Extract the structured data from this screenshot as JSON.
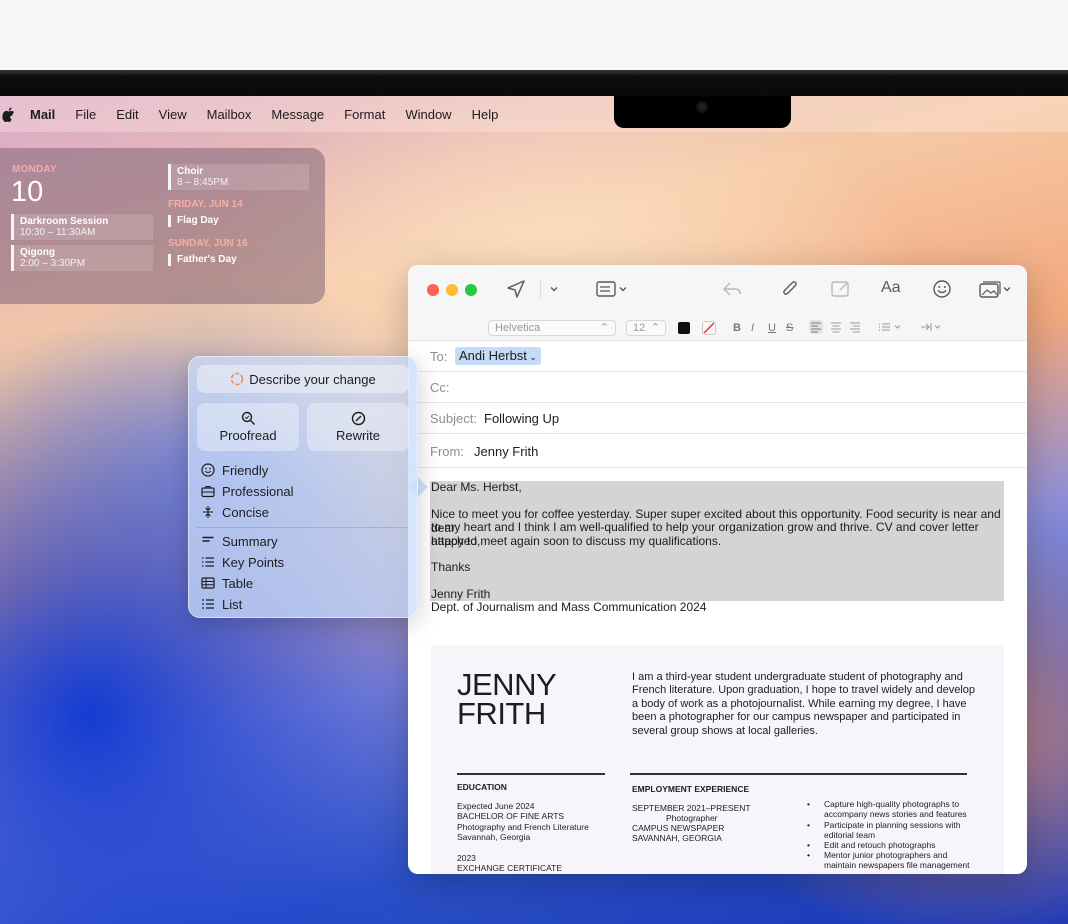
{
  "menubar": {
    "app": "Mail",
    "items": [
      "File",
      "Edit",
      "View",
      "Mailbox",
      "Message",
      "Format",
      "Window",
      "Help"
    ]
  },
  "widget": {
    "day": "MONDAY",
    "date": "10",
    "events_left": [
      {
        "title": "Darkroom Session",
        "time": "10:30 – 11:30AM"
      },
      {
        "title": "Qigong",
        "time": "2:00 – 3:30PM"
      }
    ],
    "choir": {
      "title": "Choir",
      "time": "8 – 8:45PM"
    },
    "friday_header": "FRIDAY, JUN 14",
    "friday_event": "Flag Day",
    "sunday_header": "SUNDAY, JUN 16",
    "sunday_event": "Father's Day"
  },
  "format_bar": {
    "font": "Helvetica",
    "size": "12",
    "bold": "B",
    "italic": "I",
    "underline": "U",
    "strike": "S"
  },
  "mail": {
    "to_label": "To:",
    "to_value": "Andi Herbst",
    "cc_label": "Cc:",
    "subject_label": "Subject:",
    "subject_value": "Following Up",
    "from_label": "From:",
    "from_value": "Jenny Frith",
    "font_button": "Aa",
    "body": {
      "greeting": "Dear Ms. Herbst,",
      "line1": "Nice to meet you for coffee yesterday. Super super excited about this opportunity. Food security is near and dear",
      "line2": "to my heart and I think I am well-qualified to help your organization grow and thrive. CV and cover letter attached,",
      "line3": "happy to meet again soon to discuss my qualifications.",
      "thanks": "Thanks",
      "sig_name": "Jenny Frith",
      "sig_dept": "Dept. of Journalism and Mass Communication 2024"
    }
  },
  "resume": {
    "name_line1": "JENNY",
    "name_line2": "FRITH",
    "bio": "I am a third-year student undergraduate student of photography and French literature. Upon graduation, I hope to travel widely and develop a body of work as a photojournalist. While earning my degree, I have been a photographer for our campus newspaper and participated in several group shows at local galleries.",
    "education_header": "EDUCATION",
    "edu_1": "Expected June 2024",
    "edu_2": "BACHELOR OF FINE ARTS",
    "edu_3": "Photography and French Literature",
    "edu_4": "Savannah, Georgia",
    "edu_5": "2023",
    "edu_6": "EXCHANGE CERTIFICATE",
    "employment_header": "EMPLOYMENT EXPERIENCE",
    "emp_1": "SEPTEMBER 2021–PRESENT",
    "emp_2": "Photographer",
    "emp_3": "CAMPUS NEWSPAPER",
    "emp_4": "SAVANNAH, GEORGIA",
    "bullets": [
      "Capture high-quality photographs to",
      "accompany news stories and features",
      "Participate in planning sessions with",
      "editorial team",
      "Edit and retouch photographs",
      "Mentor junior photographers and",
      "maintain newspapers file management"
    ]
  },
  "writing_tools": {
    "describe": "Describe your change",
    "proofread": "Proofread",
    "rewrite": "Rewrite",
    "tones": [
      "Friendly",
      "Professional",
      "Concise"
    ],
    "formats": [
      "Summary",
      "Key Points",
      "Table",
      "List"
    ]
  },
  "colors": {
    "accent": "#c5dbf6",
    "close": "#ff5f57",
    "minimize": "#febc2e",
    "zoom": "#28c840"
  }
}
